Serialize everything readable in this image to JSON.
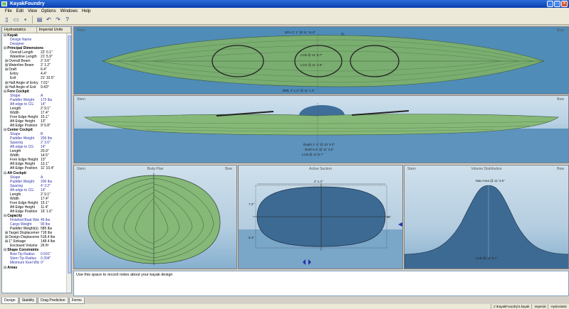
{
  "window": {
    "title": "KayakFoundry",
    "buttons": [
      "_",
      "□",
      "×"
    ]
  },
  "menu": [
    "File",
    "Edit",
    "View",
    "Options",
    "Windows",
    "Help"
  ],
  "toolbar": [
    {
      "name": "new-file-icon",
      "glyph": "▯"
    },
    {
      "name": "open-folder-icon",
      "glyph": "▭"
    },
    {
      "name": "save-icon",
      "glyph": "▪"
    },
    {
      "name": "print-icon",
      "glyph": "▤"
    },
    {
      "name": "undo-icon",
      "glyph": "↶"
    },
    {
      "name": "redo-icon",
      "glyph": "↷"
    },
    {
      "name": "help-icon",
      "glyph": "?"
    }
  ],
  "sidebar": {
    "headers": [
      "Hydrostatics",
      "Imperial Units"
    ],
    "rows": [
      {
        "k": "Kayak",
        "v": "",
        "type": "head"
      },
      {
        "k": "Design Name",
        "v": "",
        "type": "blue"
      },
      {
        "k": "Designer",
        "v": "",
        "type": "blue"
      },
      {
        "k": "Principal Dimensions",
        "v": "",
        "type": "head"
      },
      {
        "k": "Overall Length",
        "v": "22' 0.1\"",
        "type": ""
      },
      {
        "k": "Waterline Length",
        "v": "21' 5.9\"",
        "type": ""
      },
      {
        "k": "Overall Beam",
        "v": "2' 3.6\"",
        "type": "sub"
      },
      {
        "k": "Waterline Beam",
        "v": "2' 1.2\"",
        "type": "sub"
      },
      {
        "k": "Draft",
        "v": "6.4\"",
        "type": "sub"
      },
      {
        "k": "Entry",
        "v": "4.4\"",
        "type": ""
      },
      {
        "k": "Exit",
        "v": "21' 10.5\"",
        "type": ""
      },
      {
        "k": "Half Angle of Entry",
        "v": "7.01°",
        "type": "sub"
      },
      {
        "k": "Half Angle of Exit",
        "v": "9.43°",
        "type": "sub"
      },
      {
        "k": "Fore Cockpit",
        "v": "",
        "type": "head"
      },
      {
        "k": "Shape",
        "v": "A",
        "type": "blue"
      },
      {
        "k": "Paddler Weight",
        "v": "173 lbs",
        "type": "blue"
      },
      {
        "k": "Aft edge to CG",
        "v": "14\"",
        "type": "blue"
      },
      {
        "k": "Length",
        "v": "2' 9.1\"",
        "type": ""
      },
      {
        "k": "Width",
        "v": "17.4\"",
        "type": ""
      },
      {
        "k": "Fore Edge Height",
        "v": "15.1\"",
        "type": ""
      },
      {
        "k": "Aft Edge Height",
        "v": "13\"",
        "type": ""
      },
      {
        "k": "Aft Edge Position",
        "v": "9' 6.8\"",
        "type": ""
      },
      {
        "k": "Center Cockpit",
        "v": "",
        "type": "head"
      },
      {
        "k": "Shape",
        "v": "B",
        "type": "blue"
      },
      {
        "k": "Paddler Weight",
        "v": "206 lbs",
        "type": "blue"
      },
      {
        "k": "Spacing",
        "v": "2' 3.6\"",
        "type": "blue"
      },
      {
        "k": "Aft edge to CG",
        "v": "14\"",
        "type": "blue"
      },
      {
        "k": "Length",
        "v": "20.9\"",
        "type": ""
      },
      {
        "k": "Width",
        "v": "14.5\"",
        "type": ""
      },
      {
        "k": "Fore Edge Height",
        "v": "13\"",
        "type": ""
      },
      {
        "k": "Aft Edge Height",
        "v": "13.1\"",
        "type": ""
      },
      {
        "k": "Aft Edge Position",
        "v": "11' 10.4\"",
        "type": ""
      },
      {
        "k": "Aft Cockpit",
        "v": "",
        "type": "head"
      },
      {
        "k": "Shape",
        "v": "A",
        "type": "blue"
      },
      {
        "k": "Paddler Weight",
        "v": "206 lbs",
        "type": "blue"
      },
      {
        "k": "Spacing",
        "v": "4' 3.2\"",
        "type": "blue"
      },
      {
        "k": "Aft edge to CG",
        "v": "14\"",
        "type": "blue"
      },
      {
        "k": "Length",
        "v": "2' 9.1\"",
        "type": ""
      },
      {
        "k": "Width",
        "v": "17.4\"",
        "type": ""
      },
      {
        "k": "Fore Edge Height",
        "v": "15.1\"",
        "type": ""
      },
      {
        "k": "Aft Edge Height",
        "v": "11.4\"",
        "type": ""
      },
      {
        "k": "Aft Edge Position",
        "v": "16' 1.6\"",
        "type": ""
      },
      {
        "k": "Capacity",
        "v": "",
        "type": "head"
      },
      {
        "k": "Finished Boat Weight",
        "v": "45 lbs",
        "type": "blue"
      },
      {
        "k": "Cargo Weight",
        "v": "90 lbs",
        "type": "blue"
      },
      {
        "k": "Paddler Weight(s)",
        "v": "585 lbs",
        "type": ""
      },
      {
        "k": "Target Displacement",
        "v": "718 lbs",
        "type": "sub"
      },
      {
        "k": "Design Displacement",
        "v": "518.4 lbs",
        "type": "sub"
      },
      {
        "k": "1\" Sinkage",
        "v": "148.4 lbs",
        "type": "sub"
      },
      {
        "k": "Enclosed Volume",
        "v": "26 ft³",
        "type": ""
      },
      {
        "k": "Shape Constraints",
        "v": "",
        "type": "head"
      },
      {
        "k": "Bow Tip Radius",
        "v": "0.591\"",
        "type": "blue"
      },
      {
        "k": "Stern Tip Radius",
        "v": "0.394\"",
        "type": "blue"
      },
      {
        "k": "Minimum Keel Width",
        "v": "0\"",
        "type": "blue"
      },
      {
        "k": "Areas",
        "v": "",
        "type": "head"
      }
    ]
  },
  "views": {
    "plan": {
      "stern": "Stern",
      "bow": "Bow",
      "labels": [
        "BOA 2' 1\" @ 11' 11.9\"",
        "LCB @ 11' 5.7\"",
        "LCG @ 11' 4.6\"",
        "BWL 2' 1.2\" @ 11' 1.2\""
      ]
    },
    "profile": {
      "stern": "Stern",
      "bow": "Bow",
      "labels": [
        "Depth 1' 4\" @ 10' 9.3\"",
        "Draft 6.4\" @ 11' 3.6\"",
        "LCB @ 11' 5.7\""
      ]
    },
    "bodyplan": {
      "stern": "Stern",
      "title": "Body Plan",
      "bow": "Bow"
    },
    "section": {
      "title": "Active Section",
      "top": "2' 1.3\"",
      "left": "7.3\"",
      "right": "11\"",
      "small": "6.4\""
    },
    "volume": {
      "stern": "Stern",
      "title": "Volume Distribution",
      "bow": "Bow",
      "max": "Max Area @ 11' 3.6\"",
      "lcb": "LCB @ 11' 5.7\""
    }
  },
  "notes": {
    "placeholder": "Use this space to record notes about your kayak design"
  },
  "tabs": [
    "Design",
    "Stability",
    "Drag Prediction",
    "Forms"
  ],
  "status": [
    "c:\\KayakFoundry\\1.kayak",
    "Imperial",
    "Hydrostatic"
  ]
}
